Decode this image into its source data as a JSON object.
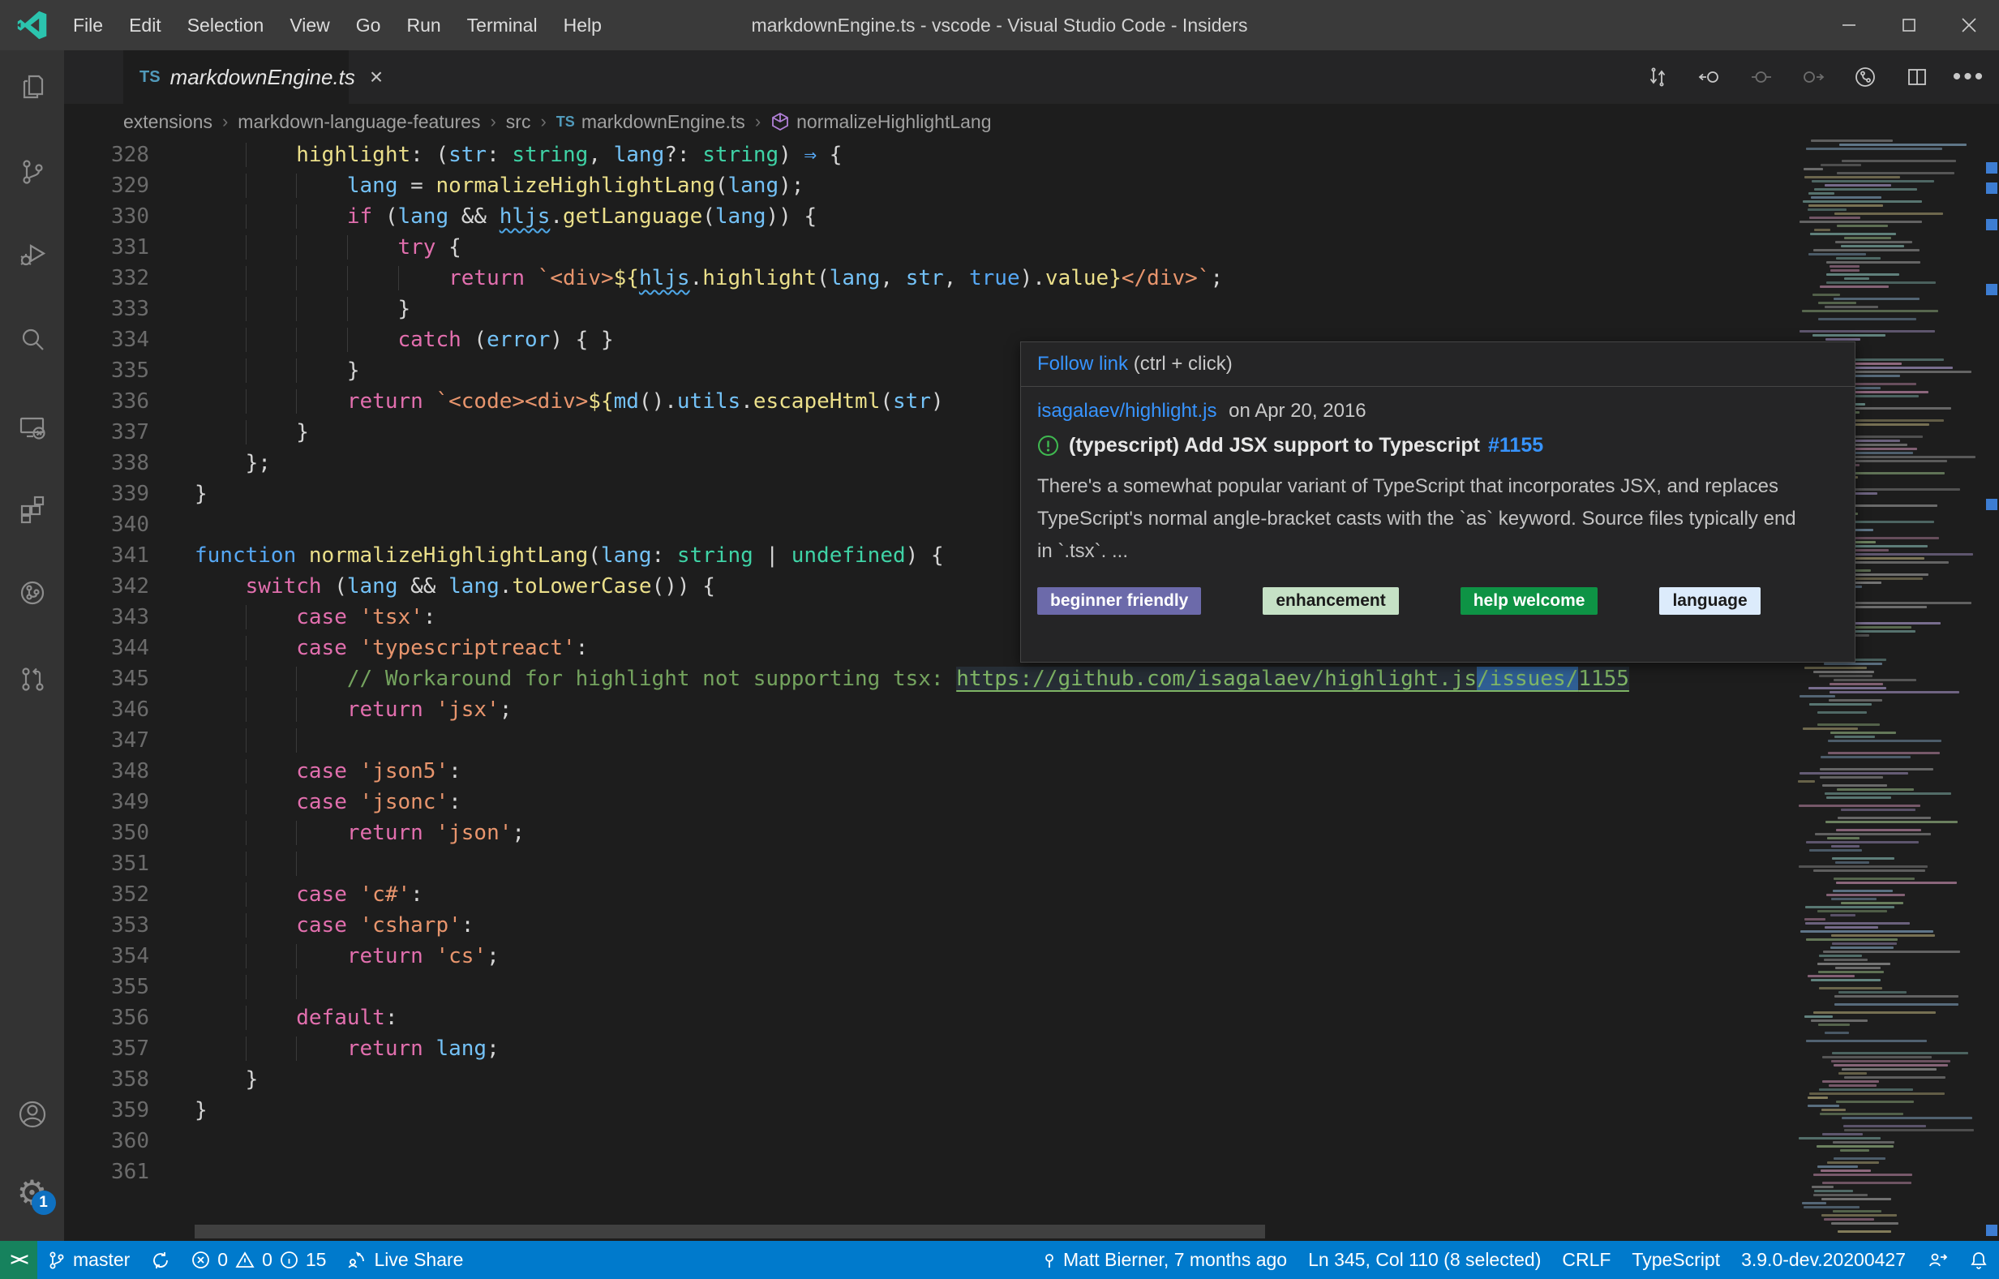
{
  "title_bar": {
    "menus": [
      "File",
      "Edit",
      "Selection",
      "View",
      "Go",
      "Run",
      "Terminal",
      "Help"
    ],
    "title": "markdownEngine.ts - vscode - Visual Studio Code - Insiders",
    "window": {
      "minimize": "minimize",
      "maximize": "maximize",
      "close": "close"
    }
  },
  "activity_bar": {
    "items": [
      "explorer",
      "source-control",
      "run-and-debug",
      "search",
      "remote-explorer",
      "extensions",
      "gitlens",
      "github-pull-requests",
      "account",
      "settings"
    ],
    "settings_badge": "1"
  },
  "tab": {
    "icon_text": "TS",
    "label": "markdownEngine.ts",
    "close": "×"
  },
  "breadcrumb": {
    "separator": "›",
    "folders": [
      "extensions",
      "markdown-language-features",
      "src"
    ],
    "file": {
      "icon_text": "TS",
      "label": "markdownEngine.ts"
    },
    "symbol": "normalizeHighlightLang"
  },
  "editor": {
    "lines": [
      {
        "n": 328,
        "i": 2,
        "t": [
          [
            "fn",
            "highlight"
          ],
          [
            "pl",
            ": ("
          ],
          [
            "vr",
            "str"
          ],
          [
            "pl",
            ": "
          ],
          [
            "ty",
            "string"
          ],
          [
            "pl",
            ", "
          ],
          [
            "vr",
            "lang"
          ],
          [
            "pl",
            "?: "
          ],
          [
            "ty",
            "string"
          ],
          [
            "pl",
            ") "
          ],
          [
            "kb",
            "⇒"
          ],
          [
            "pl",
            " {"
          ]
        ]
      },
      {
        "n": 329,
        "i": 3,
        "t": [
          [
            "vr",
            "lang"
          ],
          [
            "pl",
            " = "
          ],
          [
            "fn",
            "normalizeHighlightLang"
          ],
          [
            "pl",
            "("
          ],
          [
            "vr",
            "lang"
          ],
          [
            "pl",
            ");"
          ]
        ]
      },
      {
        "n": 330,
        "i": 3,
        "t": [
          [
            "kw",
            "if"
          ],
          [
            "pl",
            " ("
          ],
          [
            "vr",
            "lang"
          ],
          [
            "pl",
            " && "
          ],
          [
            "vr sq",
            "hljs"
          ],
          [
            "pl",
            "."
          ],
          [
            "fn",
            "getLanguage"
          ],
          [
            "pl",
            "("
          ],
          [
            "vr",
            "lang"
          ],
          [
            "pl",
            ")) {"
          ]
        ]
      },
      {
        "n": 331,
        "i": 4,
        "t": [
          [
            "kw",
            "try"
          ],
          [
            "pl",
            " {"
          ]
        ]
      },
      {
        "n": 332,
        "i": 5,
        "t": [
          [
            "kw",
            "return"
          ],
          [
            "pl",
            " "
          ],
          [
            "st",
            "`<div>"
          ],
          [
            "fn",
            "${"
          ],
          [
            "vr sq",
            "hljs"
          ],
          [
            "pl",
            "."
          ],
          [
            "fn",
            "highlight"
          ],
          [
            "pl",
            "("
          ],
          [
            "vr",
            "lang"
          ],
          [
            "pl",
            ", "
          ],
          [
            "vr",
            "str"
          ],
          [
            "pl",
            ", "
          ],
          [
            "kb",
            "true"
          ],
          [
            "pl",
            ")."
          ],
          [
            "fn",
            "value"
          ],
          [
            "fn",
            "}"
          ],
          [
            "st",
            "</div>`"
          ],
          [
            "pl",
            ";"
          ]
        ]
      },
      {
        "n": 333,
        "i": 4,
        "t": [
          [
            "pl",
            "}"
          ]
        ]
      },
      {
        "n": 334,
        "i": 4,
        "t": [
          [
            "kw",
            "catch"
          ],
          [
            "pl",
            " ("
          ],
          [
            "vr",
            "error"
          ],
          [
            "pl",
            ") { }"
          ]
        ]
      },
      {
        "n": 335,
        "i": 3,
        "t": [
          [
            "pl",
            "}"
          ]
        ]
      },
      {
        "n": 336,
        "i": 3,
        "t": [
          [
            "kw",
            "return"
          ],
          [
            "pl",
            " "
          ],
          [
            "st",
            "`<code><div>"
          ],
          [
            "fn",
            "${"
          ],
          [
            "vr",
            "md"
          ],
          [
            "pl",
            "()."
          ],
          [
            "vr",
            "utils"
          ],
          [
            "pl",
            "."
          ],
          [
            "fn",
            "escapeHtml"
          ],
          [
            "pl",
            "("
          ],
          [
            "vr",
            "str"
          ],
          [
            "pl",
            ")"
          ]
        ]
      },
      {
        "n": 337,
        "i": 2,
        "t": [
          [
            "pl",
            "}"
          ]
        ]
      },
      {
        "n": 338,
        "i": 1,
        "t": [
          [
            "pl",
            "};"
          ]
        ]
      },
      {
        "n": 339,
        "i": 0,
        "t": [
          [
            "pl",
            "}"
          ]
        ]
      },
      {
        "n": 340,
        "i": 0,
        "t": []
      },
      {
        "n": 341,
        "i": 0,
        "t": [
          [
            "kb",
            "function"
          ],
          [
            "pl",
            " "
          ],
          [
            "fn",
            "normalizeHighlightLang"
          ],
          [
            "pl",
            "("
          ],
          [
            "vr",
            "lang"
          ],
          [
            "pl",
            ": "
          ],
          [
            "ty",
            "string"
          ],
          [
            "pl",
            " | "
          ],
          [
            "ty",
            "undefined"
          ],
          [
            "pl",
            ") {"
          ]
        ]
      },
      {
        "n": 342,
        "i": 1,
        "t": [
          [
            "kw",
            "switch"
          ],
          [
            "pl",
            " ("
          ],
          [
            "vr",
            "lang"
          ],
          [
            "pl",
            " && "
          ],
          [
            "vr",
            "lang"
          ],
          [
            "pl",
            "."
          ],
          [
            "fn",
            "toLowerCase"
          ],
          [
            "pl",
            "()) {"
          ]
        ]
      },
      {
        "n": 343,
        "i": 2,
        "t": [
          [
            "kw",
            "case"
          ],
          [
            "pl",
            " "
          ],
          [
            "st",
            "'tsx'"
          ],
          [
            "pl",
            ":"
          ]
        ]
      },
      {
        "n": 344,
        "i": 2,
        "t": [
          [
            "kw",
            "case"
          ],
          [
            "pl",
            " "
          ],
          [
            "st",
            "'typescriptreact'"
          ],
          [
            "pl",
            ":"
          ]
        ]
      },
      {
        "n": 345,
        "i": 3,
        "t": [
          [
            "cm",
            "// Workaround for highlight not supporting tsx: "
          ],
          [
            "lk lkbg",
            "https://github.com/isagalaev/highlight.js"
          ],
          [
            "lk lkbg sel",
            "/issues/"
          ],
          [
            "lk lkbg",
            "1155"
          ]
        ]
      },
      {
        "n": 346,
        "i": 3,
        "t": [
          [
            "kw",
            "return"
          ],
          [
            "pl",
            " "
          ],
          [
            "st",
            "'jsx'"
          ],
          [
            "pl",
            ";"
          ]
        ]
      },
      {
        "n": 347,
        "i": 3,
        "t": []
      },
      {
        "n": 348,
        "i": 2,
        "t": [
          [
            "kw",
            "case"
          ],
          [
            "pl",
            " "
          ],
          [
            "st",
            "'json5'"
          ],
          [
            "pl",
            ":"
          ]
        ]
      },
      {
        "n": 349,
        "i": 2,
        "t": [
          [
            "kw",
            "case"
          ],
          [
            "pl",
            " "
          ],
          [
            "st",
            "'jsonc'"
          ],
          [
            "pl",
            ":"
          ]
        ]
      },
      {
        "n": 350,
        "i": 3,
        "t": [
          [
            "kw",
            "return"
          ],
          [
            "pl",
            " "
          ],
          [
            "st",
            "'json'"
          ],
          [
            "pl",
            ";"
          ]
        ]
      },
      {
        "n": 351,
        "i": 3,
        "t": []
      },
      {
        "n": 352,
        "i": 2,
        "t": [
          [
            "kw",
            "case"
          ],
          [
            "pl",
            " "
          ],
          [
            "st",
            "'c#'"
          ],
          [
            "pl",
            ":"
          ]
        ]
      },
      {
        "n": 353,
        "i": 2,
        "t": [
          [
            "kw",
            "case"
          ],
          [
            "pl",
            " "
          ],
          [
            "st",
            "'csharp'"
          ],
          [
            "pl",
            ":"
          ]
        ]
      },
      {
        "n": 354,
        "i": 3,
        "t": [
          [
            "kw",
            "return"
          ],
          [
            "pl",
            " "
          ],
          [
            "st",
            "'cs'"
          ],
          [
            "pl",
            ";"
          ]
        ]
      },
      {
        "n": 355,
        "i": 3,
        "t": []
      },
      {
        "n": 356,
        "i": 2,
        "t": [
          [
            "kw",
            "default"
          ],
          [
            "pl",
            ":"
          ]
        ]
      },
      {
        "n": 357,
        "i": 3,
        "t": [
          [
            "kw",
            "return"
          ],
          [
            "pl",
            " "
          ],
          [
            "vr",
            "lang"
          ],
          [
            "pl",
            ";"
          ]
        ]
      },
      {
        "n": 358,
        "i": 1,
        "t": [
          [
            "pl",
            "}"
          ]
        ]
      },
      {
        "n": 359,
        "i": 0,
        "t": [
          [
            "pl",
            "}"
          ]
        ]
      },
      {
        "n": 360,
        "i": 0,
        "t": []
      },
      {
        "n": 361,
        "i": 0,
        "t": []
      }
    ]
  },
  "popup": {
    "header": {
      "link": "Follow link",
      "hint": "(ctrl + click)"
    },
    "repo_link": "isagalaev/highlight.js",
    "date": "on Apr 20, 2016",
    "issue": {
      "title": "(typescript) Add JSX support to Typescript",
      "number": "#1155"
    },
    "body": "There's a somewhat popular variant of TypeScript that incorporates JSX, and replaces TypeScript's normal angle-bracket casts with the `as` keyword. Source files typically end in `.tsx`. ...",
    "labels": [
      {
        "text": "beginner friendly",
        "bg": "#6c6aaa",
        "fg": "#ffffff"
      },
      {
        "text": "enhancement",
        "bg": "#c5e1c5",
        "fg": "#1b1b1b"
      },
      {
        "text": "help welcome",
        "bg": "#0e9345",
        "fg": "#ffffff"
      },
      {
        "text": "language",
        "bg": "#dcebfb",
        "fg": "#1b1b1b"
      }
    ]
  },
  "minimap": {
    "ruler_marks": [
      200,
      225,
      270,
      350,
      615,
      1510
    ]
  },
  "status_bar": {
    "remote": "><",
    "branch": "master",
    "errors": "0",
    "warnings": "0",
    "infos": "15",
    "live_share": "Live Share",
    "author": "Matt Bierner, 7 months ago",
    "cursor": "Ln 345, Col 110 (8 selected)",
    "eol": "CRLF",
    "language": "TypeScript",
    "version": "3.9.0-dev.20200427"
  },
  "colors": {
    "status_accent": "#007acc",
    "remote_green": "#16825d",
    "popup_link": "#3794ff",
    "issue_open_green": "#3fb950",
    "selection_blue": "#2f5e93"
  }
}
